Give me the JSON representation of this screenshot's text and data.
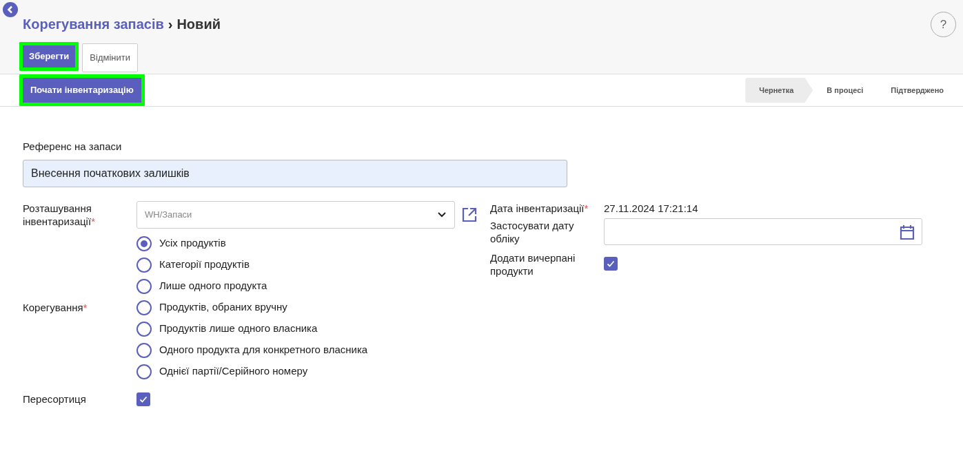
{
  "breadcrumb": {
    "parent": "Корегування запасів",
    "separator": "›",
    "current": "Новий"
  },
  "actions": [
    {
      "label": "Зберегти",
      "kind": "primary",
      "highlighted": true
    },
    {
      "label": "Відмінити",
      "kind": "secondary",
      "highlighted": false
    }
  ],
  "header_button": {
    "label": "Почати інвентаризацію",
    "highlighted": true
  },
  "help": "?",
  "stages": [
    {
      "label": "Чернетка",
      "selected": true
    },
    {
      "label": "В процесі",
      "selected": false
    },
    {
      "label": "Підтверджено",
      "selected": false
    }
  ],
  "reference": {
    "label": "Референс на запаси",
    "value": "Внесення початкових залишків"
  },
  "location": {
    "label": "Розташування інвентаризації",
    "required_mark": "*",
    "placeholder": "WH/Запаси"
  },
  "adjustment": {
    "label": "Корегування",
    "required_mark": "*",
    "options": [
      {
        "label": "Усіх продуктів",
        "selected": true
      },
      {
        "label": "Категорії продуктів",
        "selected": false
      },
      {
        "label": "Лише одного продукта",
        "selected": false
      },
      {
        "label": "Продуктів, обраних вручну",
        "selected": false
      },
      {
        "label": "Продуктів лише одного власника",
        "selected": false
      },
      {
        "label": "Одного продукта для конкретного власника",
        "selected": false
      },
      {
        "label": "Однієї партії/Серійного номеру",
        "selected": false
      }
    ]
  },
  "resorting": {
    "label": "Пересортиця",
    "checked": true
  },
  "inventory_date": {
    "label": "Дата інвентаризації",
    "required_mark": "*",
    "value": "27.11.2024 17:21:14"
  },
  "accounting_date": {
    "label": "Застосувати дату обліку"
  },
  "include_exhausted": {
    "label": "Додати вичерпані продукти",
    "checked": true
  }
}
